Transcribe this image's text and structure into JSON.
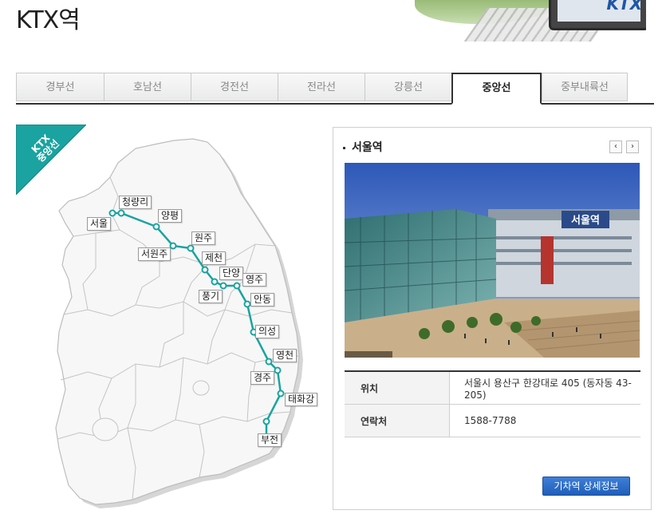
{
  "page": {
    "title": "KTX역"
  },
  "banner": {
    "logo_text": "KTX"
  },
  "tabs": [
    {
      "label": "경부선",
      "active": false
    },
    {
      "label": "호남선",
      "active": false
    },
    {
      "label": "경전선",
      "active": false
    },
    {
      "label": "전라선",
      "active": false
    },
    {
      "label": "강릉선",
      "active": false
    },
    {
      "label": "중앙선",
      "active": true
    },
    {
      "label": "중부내륙선",
      "active": false
    }
  ],
  "map": {
    "ribbon_line1": "KTX",
    "ribbon_line2": "중앙선",
    "line_color": "#1aa3a0",
    "stations": [
      "서울",
      "청량리",
      "양평",
      "서원주",
      "원주",
      "제천",
      "단양",
      "풍기",
      "영주",
      "안동",
      "의성",
      "영천",
      "경주",
      "태화강",
      "부전"
    ]
  },
  "panel": {
    "station_name": "서울역",
    "prev_icon": "◀",
    "next_icon": "▶",
    "photo_sign": "서울역",
    "rows": [
      {
        "label": "위치",
        "value": "서울시 용산구 한강대로 405 (동자동 43-205)"
      },
      {
        "label": "연락처",
        "value": "1588-7788"
      }
    ],
    "detail_button": "기차역 상세정보"
  },
  "colors": {
    "accent": "#1aa3a0",
    "button": "#2a68c4"
  }
}
